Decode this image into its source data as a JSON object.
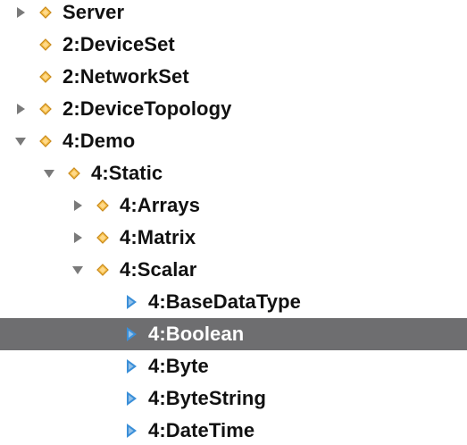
{
  "tree": {
    "rows": [
      {
        "label": "Server",
        "expander": "collapsed",
        "node_icon": "object-diamond-icon",
        "depth": 0,
        "selected": false
      },
      {
        "label": "2:DeviceSet",
        "expander": "none",
        "node_icon": "object-diamond-icon",
        "depth": 0,
        "selected": false
      },
      {
        "label": "2:NetworkSet",
        "expander": "none",
        "node_icon": "object-diamond-icon",
        "depth": 0,
        "selected": false
      },
      {
        "label": "2:DeviceTopology",
        "expander": "collapsed",
        "node_icon": "object-diamond-icon",
        "depth": 0,
        "selected": false
      },
      {
        "label": "4:Demo",
        "expander": "expanded",
        "node_icon": "object-diamond-icon",
        "depth": 0,
        "selected": false
      },
      {
        "label": "4:Static",
        "expander": "expanded",
        "node_icon": "object-diamond-icon",
        "depth": 1,
        "selected": false
      },
      {
        "label": "4:Arrays",
        "expander": "collapsed",
        "node_icon": "object-diamond-icon",
        "depth": 2,
        "selected": false
      },
      {
        "label": "4:Matrix",
        "expander": "collapsed",
        "node_icon": "object-diamond-icon",
        "depth": 2,
        "selected": false
      },
      {
        "label": "4:Scalar",
        "expander": "expanded",
        "node_icon": "object-diamond-icon",
        "depth": 2,
        "selected": false
      },
      {
        "label": "4:BaseDataType",
        "expander": "none",
        "node_icon": "variable-triangle-icon",
        "depth": 3,
        "selected": false
      },
      {
        "label": "4:Boolean",
        "expander": "none",
        "node_icon": "variable-triangle-icon",
        "depth": 3,
        "selected": true
      },
      {
        "label": "4:Byte",
        "expander": "none",
        "node_icon": "variable-triangle-icon",
        "depth": 3,
        "selected": false
      },
      {
        "label": "4:ByteString",
        "expander": "none",
        "node_icon": "variable-triangle-icon",
        "depth": 3,
        "selected": false
      },
      {
        "label": "4:DateTime",
        "expander": "none",
        "node_icon": "variable-triangle-icon",
        "depth": 3,
        "selected": false
      }
    ]
  },
  "colors": {
    "selection_bg": "#6e6e70",
    "object_icon_fill": "#f5c04a",
    "object_icon_stroke": "#c98a1d",
    "variable_icon_fill": "#3b8fd8",
    "expander": "#7a7a7a",
    "text": "#111111",
    "selected_text": "#ffffff"
  }
}
